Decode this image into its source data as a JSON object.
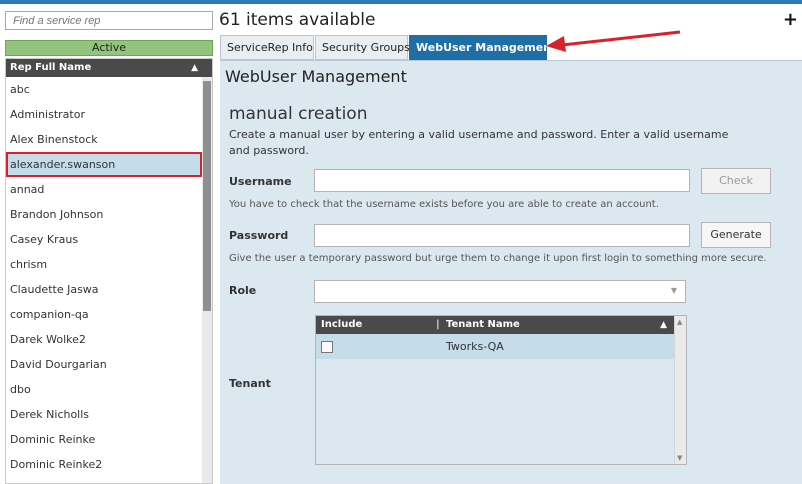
{
  "search": {
    "placeholder": "Find a service rep"
  },
  "status_header": "Active",
  "list": {
    "column": "Rep Full Name",
    "items": [
      "abc",
      "Administrator",
      "Alex Binenstock",
      "alexander.swanson",
      "annad",
      "Brandon Johnson",
      "Casey Kraus",
      "chrism",
      "Claudette Jaswa",
      "companion-qa",
      "Darek Wolke2",
      "David Dourgarian",
      "dbo",
      "Derek Nicholls",
      "Dominic Reinke",
      "Dominic Reinke2"
    ],
    "selected_index": 3
  },
  "header": {
    "items_count": "61 items available",
    "add_label": "+"
  },
  "tabs": [
    {
      "label": "ServiceRep Info"
    },
    {
      "label": "Security Groups"
    },
    {
      "label": "WebUser Management"
    }
  ],
  "webuser": {
    "title": "WebUser Management",
    "section_title": "manual creation",
    "description": "Create a manual user by entering a valid username and password. Enter a valid username and password.",
    "username_label": "Username",
    "username_value": "",
    "check_button": "Check",
    "username_hint": "You have to check that the username exists before you are able to create an account.",
    "password_label": "Password",
    "password_value": "",
    "generate_button": "Generate",
    "password_hint": "Give the user a temporary password but urge them to change it upon first login to something more secure.",
    "role_label": "Role",
    "role_value": "",
    "tenant_label": "Tenant",
    "tenant_grid": {
      "col_include": "Include",
      "col_tenant": "Tenant Name",
      "rows": [
        {
          "include": false,
          "tenant": "Tworks-QA"
        }
      ]
    }
  },
  "colors": {
    "accent_tab": "#1f6fa6",
    "active_header": "#93c47d",
    "selection_highlight": "#c5dcea",
    "annotation_red": "#d9212b",
    "content_bg": "#dce8f0"
  }
}
